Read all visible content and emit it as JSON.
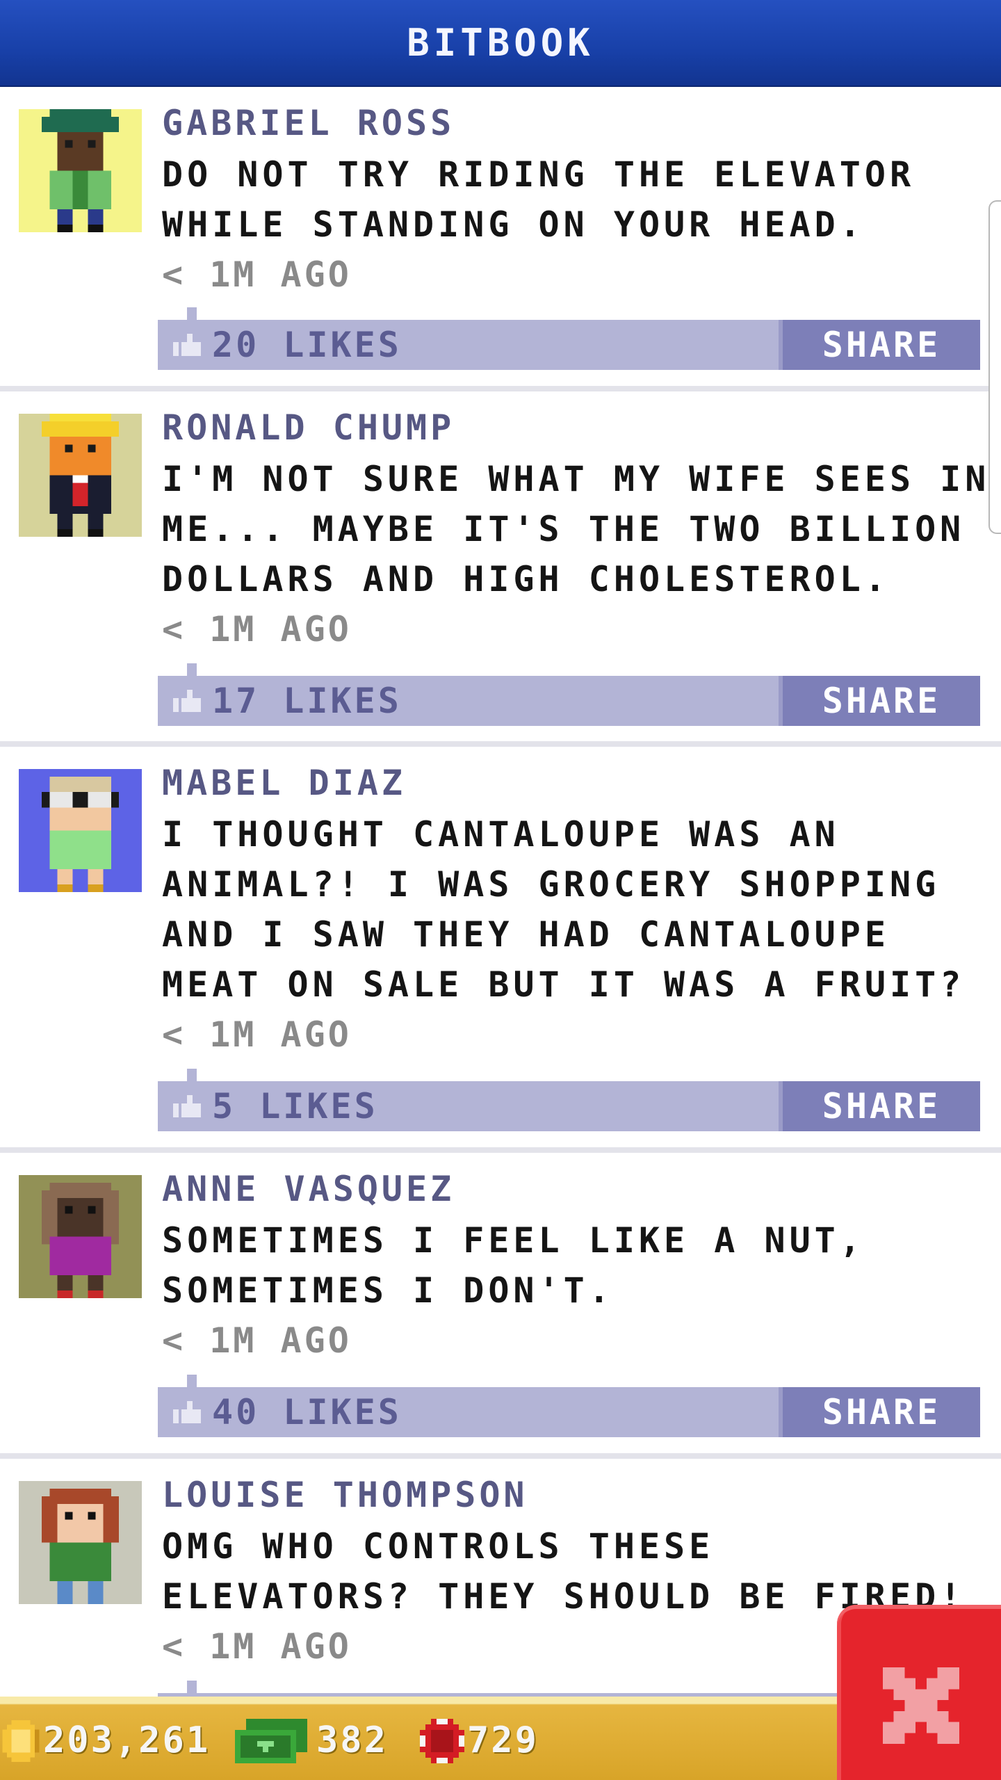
{
  "header": {
    "title": "BITBOOK"
  },
  "posts": [
    {
      "name": "GABRIEL ROSS",
      "lines": [
        "DO NOT TRY RIDING THE ELEVATOR",
        "WHILE STANDING ON YOUR HEAD."
      ],
      "time": "< 1M AGO",
      "likes": "20 LIKES",
      "share": "SHARE",
      "avatar_bg": "#f5f48a"
    },
    {
      "name": "RONALD CHUMP",
      "lines": [
        "I'M NOT SURE WHAT MY WIFE SEES IN",
        "ME... MAYBE IT'S THE TWO BILLION",
        "DOLLARS AND HIGH CHOLESTEROL."
      ],
      "time": "< 1M AGO",
      "likes": "17 LIKES",
      "share": "SHARE",
      "avatar_bg": "#d6d39a"
    },
    {
      "name": "MABEL DIAZ",
      "lines": [
        "I THOUGHT CANTALOUPE WAS AN",
        "ANIMAL?! I WAS GROCERY SHOPPING",
        "AND I SAW THEY HAD CANTALOUPE",
        "MEAT ON SALE BUT IT WAS A FRUIT?"
      ],
      "time": "< 1M AGO",
      "likes": "5 LIKES",
      "share": "SHARE",
      "avatar_bg": "#5d63e6"
    },
    {
      "name": "ANNE VASQUEZ",
      "lines": [
        "SOMETIMES I FEEL LIKE A NUT,",
        "SOMETIMES I DON'T."
      ],
      "time": "< 1M AGO",
      "likes": "40 LIKES",
      "share": "SHARE",
      "avatar_bg": "#929156"
    },
    {
      "name": "LOUISE THOMPSON",
      "lines": [
        "OMG WHO CONTROLS THESE",
        "ELEVATORS? THEY SHOULD BE FIRED!"
      ],
      "time": "< 1M AGO",
      "avatar_bg": "#c8c8ba"
    }
  ],
  "stats": {
    "coins": "203,261",
    "bux": "382",
    "tokens": "729"
  },
  "colors": {
    "header": "#1d48b4",
    "likebar": "#b3b4d6",
    "share": "#7d7fb8",
    "close": "#e5242c",
    "bottom_bar": "#dca82e"
  }
}
